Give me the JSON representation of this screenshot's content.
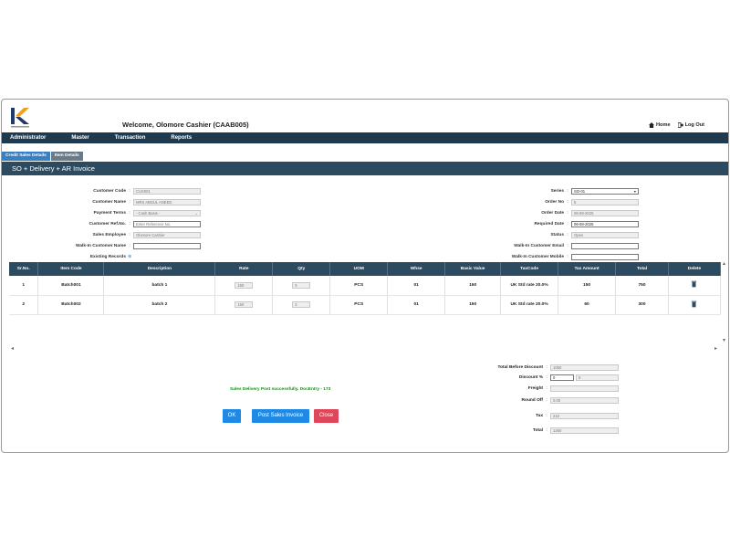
{
  "header": {
    "welcome": "Welcome,  Olomore Cashier (CAAB005)",
    "home": "Home",
    "logout": "Log Out",
    "home_icon": "home-icon",
    "logout_icon": "logout-icon"
  },
  "nav": [
    "Administrator",
    "Master",
    "Transaction",
    "Reports"
  ],
  "tabs": {
    "credit": "Credit Sales Details",
    "item": "Item Details"
  },
  "section_title": "SO + Delivery + AR Invoice",
  "left_form": {
    "customer_code": {
      "label": "Customer Code",
      "value": "CUS001"
    },
    "customer_name": {
      "label": "Customer Name",
      "value": "MRS ABDUL ANEED"
    },
    "payment_terms": {
      "label": "Payment Terms",
      "value": "- Cash Basis -"
    },
    "customer_ref": {
      "label": "Customer Ref.No.",
      "placeholder": "Enter Reference No."
    },
    "sales_employee": {
      "label": "Sales Employee",
      "value": "Olomore Cashier"
    },
    "walkin_name": {
      "label": "Walk-In Customer Name",
      "value": ""
    },
    "existing_records": {
      "label": "Existing Records"
    }
  },
  "right_form": {
    "series": {
      "label": "Series",
      "value": "SO-01"
    },
    "order_no": {
      "label": "Order No",
      "value": "5"
    },
    "order_date": {
      "label": "Order Date",
      "value": "06-08-2025"
    },
    "required_date": {
      "label": "Required Date",
      "value": "06-08-2025"
    },
    "status": {
      "label": "Status",
      "value": "Open"
    },
    "walkin_email": {
      "label": "Walk-In Customer Email",
      "value": ""
    },
    "walkin_mobile": {
      "label": "Walk-In Customer Mobile",
      "value": ""
    }
  },
  "table": {
    "headers": [
      "Sr.No.",
      "Item Code",
      "Description",
      "Rate",
      "Qty",
      "UOM",
      "Whse",
      "Basic Value",
      "TaxCode",
      "Tax Amount",
      "Total",
      "Delete"
    ],
    "rows": [
      [
        "1",
        "Batch001",
        "batch 1",
        "150",
        "5",
        "PCS",
        "01",
        "150",
        "UK Std rate 20.0%",
        "150",
        "750"
      ],
      [
        "2",
        "Batch002",
        "batch 2",
        "150",
        "2",
        "PCS",
        "01",
        "150",
        "UK Std rate 20.0%",
        "60",
        "300"
      ]
    ]
  },
  "totals": {
    "total_before_discount": {
      "label": "Total Before Discount",
      "value": "1050"
    },
    "discount_pct": {
      "label": "Discount %",
      "value": "0",
      "value2": "0"
    },
    "freight": {
      "label": "Freight",
      "value": ""
    },
    "round_off": {
      "label": "Round Off",
      "value": "0.00"
    },
    "tax": {
      "label": "Tax",
      "value": "210"
    },
    "total": {
      "label": "Total",
      "value": "1260"
    }
  },
  "message": "Sales Delivery Post successfully. DocEntry - 173",
  "buttons": {
    "ok": "OK",
    "post": "Post Sales Invoice",
    "close": "Close"
  },
  "colors": {
    "navbar": "#1f3a4f",
    "section": "#2c4a60",
    "primary": "#1e8ae6",
    "danger": "#e0455a",
    "success": "#1e8a1e"
  }
}
